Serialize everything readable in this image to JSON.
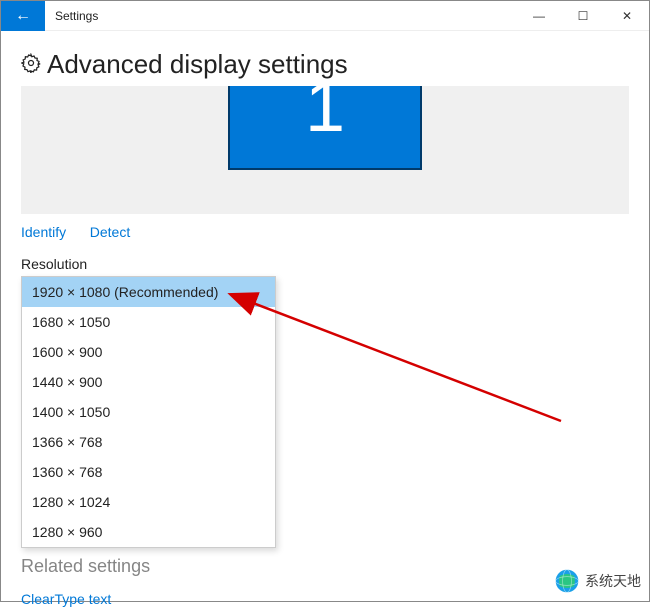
{
  "titlebar": {
    "back_glyph": "←",
    "title": "Settings",
    "min_glyph": "—",
    "max_glyph": "☐",
    "close_glyph": "✕"
  },
  "heading": "Advanced display settings",
  "monitor_number": "1",
  "links": {
    "identify": "Identify",
    "detect": "Detect"
  },
  "resolution": {
    "label": "Resolution",
    "options": [
      "1920 × 1080 (Recommended)",
      "1680 × 1050",
      "1600 × 900",
      "1440 × 900",
      "1400 × 1050",
      "1366 × 768",
      "1360 × 768",
      "1280 × 1024",
      "1280 × 960"
    ],
    "selected_index": 0
  },
  "related_heading": "Related settings",
  "cleartype": "ClearType text",
  "watermark": "系统天地"
}
